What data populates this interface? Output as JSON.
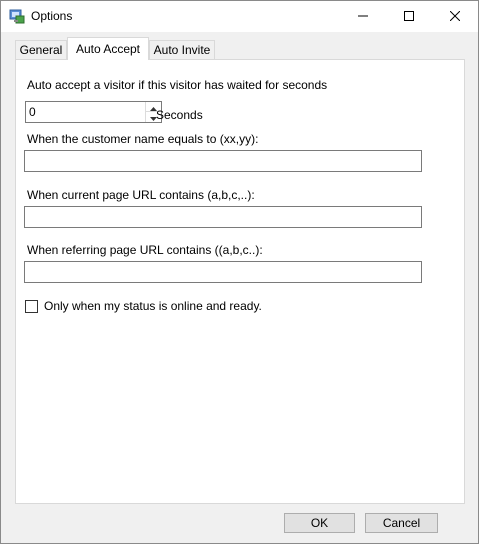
{
  "window": {
    "title": "Options",
    "app_icon": "options-app-icon",
    "controls": [
      "minimize-icon",
      "maximize-icon",
      "close-icon"
    ]
  },
  "tabs": [
    {
      "label": "General",
      "selected": false
    },
    {
      "label": "Auto Accept",
      "selected": true
    },
    {
      "label": "Auto Invite",
      "selected": false
    }
  ],
  "auto_accept": {
    "wait_label": "Auto accept a visitor if this visitor has waited for seconds",
    "seconds_value": "0",
    "seconds_unit": "Seconds",
    "customer_name_label": "When the customer name equals to (xx,yy):",
    "customer_name_value": "",
    "page_url_label": "When current page URL contains (a,b,c,..):",
    "page_url_value": "",
    "referring_url_label": "When referring page URL contains ((a,b,c..):",
    "referring_url_value": "",
    "online_checkbox_label": "Only when my status is online and ready.",
    "online_checked": false
  },
  "footer": {
    "ok_label": "OK",
    "cancel_label": "Cancel"
  }
}
